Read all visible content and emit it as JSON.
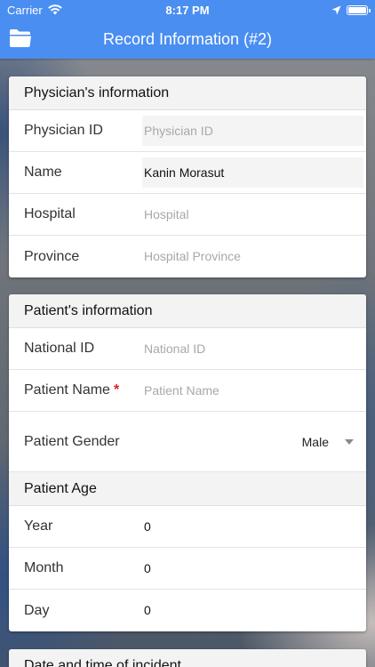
{
  "status_bar": {
    "carrier": "Carrier",
    "time": "8:17 PM"
  },
  "nav": {
    "title": "Record Information (#2)",
    "left_icon": "folder-icon"
  },
  "physician": {
    "header": "Physician's information",
    "fields": [
      {
        "label": "Physician ID",
        "value": "",
        "placeholder": "Physician ID"
      },
      {
        "label": "Name",
        "value": "Kanin Morasut",
        "placeholder": ""
      },
      {
        "label": "Hospital",
        "value": "",
        "placeholder": "Hospital"
      },
      {
        "label": "Province",
        "value": "",
        "placeholder": "Hospital Province"
      }
    ]
  },
  "patient": {
    "header": "Patient's information",
    "national_id": {
      "label": "National ID",
      "value": "",
      "placeholder": "National ID"
    },
    "name": {
      "label": "Patient Name",
      "required_mark": "*",
      "value": "",
      "placeholder": "Patient Name"
    },
    "gender": {
      "label": "Patient Gender",
      "value": "Male"
    },
    "age_header": "Patient Age",
    "age": [
      {
        "label": "Year",
        "value": "0"
      },
      {
        "label": "Month",
        "value": "0"
      },
      {
        "label": "Day",
        "value": "0"
      }
    ]
  },
  "incident": {
    "header": "Date and time of incident"
  },
  "colors": {
    "accent": "#4a8ef2",
    "required": "#e02020"
  }
}
